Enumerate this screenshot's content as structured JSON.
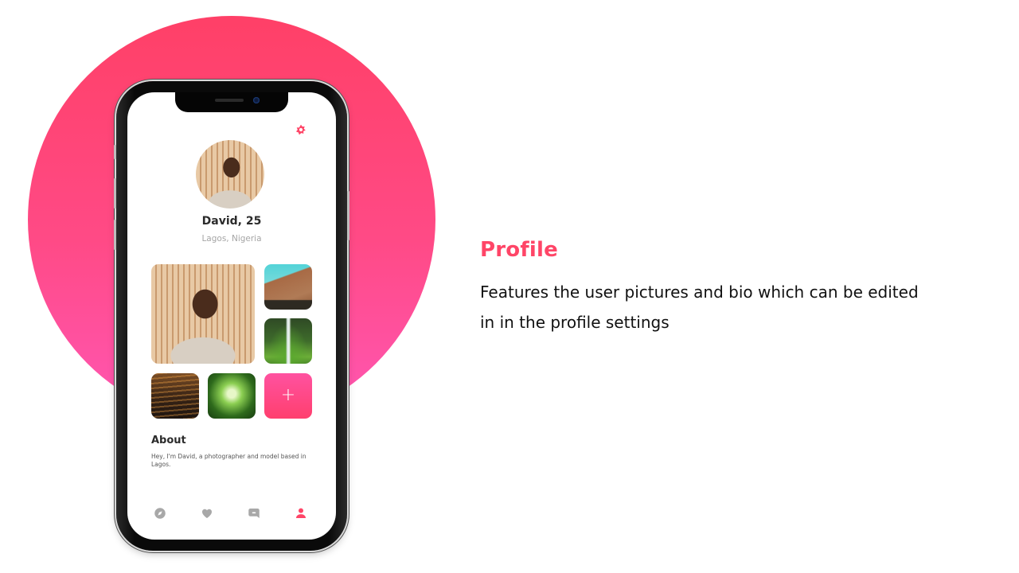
{
  "colors": {
    "accent": "#ff4567",
    "circle_top": "#ff4067",
    "circle_bottom": "#ff57b4",
    "inactive_icon": "#a8a8a8"
  },
  "profile": {
    "name_age": "David, 25",
    "location": "Lagos, Nigeria",
    "settings_icon": "gear-icon",
    "photos": [
      {
        "subject": "portrait",
        "icon": "photo"
      },
      {
        "subject": "mountain",
        "icon": "photo"
      },
      {
        "subject": "waterfall",
        "icon": "photo"
      },
      {
        "subject": "sunset-water",
        "icon": "photo"
      },
      {
        "subject": "bamboo-forest",
        "icon": "photo"
      }
    ],
    "add_photo_label": "+",
    "about": {
      "title": "About",
      "text": "Hey, I'm David, a photographer and model based in Lagos."
    }
  },
  "tabbar": {
    "items": [
      {
        "name": "discover",
        "icon": "compass-icon",
        "active": false
      },
      {
        "name": "likes",
        "icon": "heart-icon",
        "active": false
      },
      {
        "name": "messages",
        "icon": "chat-icon",
        "active": false
      },
      {
        "name": "profile",
        "icon": "user-icon",
        "active": true
      }
    ]
  },
  "feature": {
    "title": "Profile",
    "description": "Features the user pictures and bio which can be edited in in the profile settings"
  }
}
